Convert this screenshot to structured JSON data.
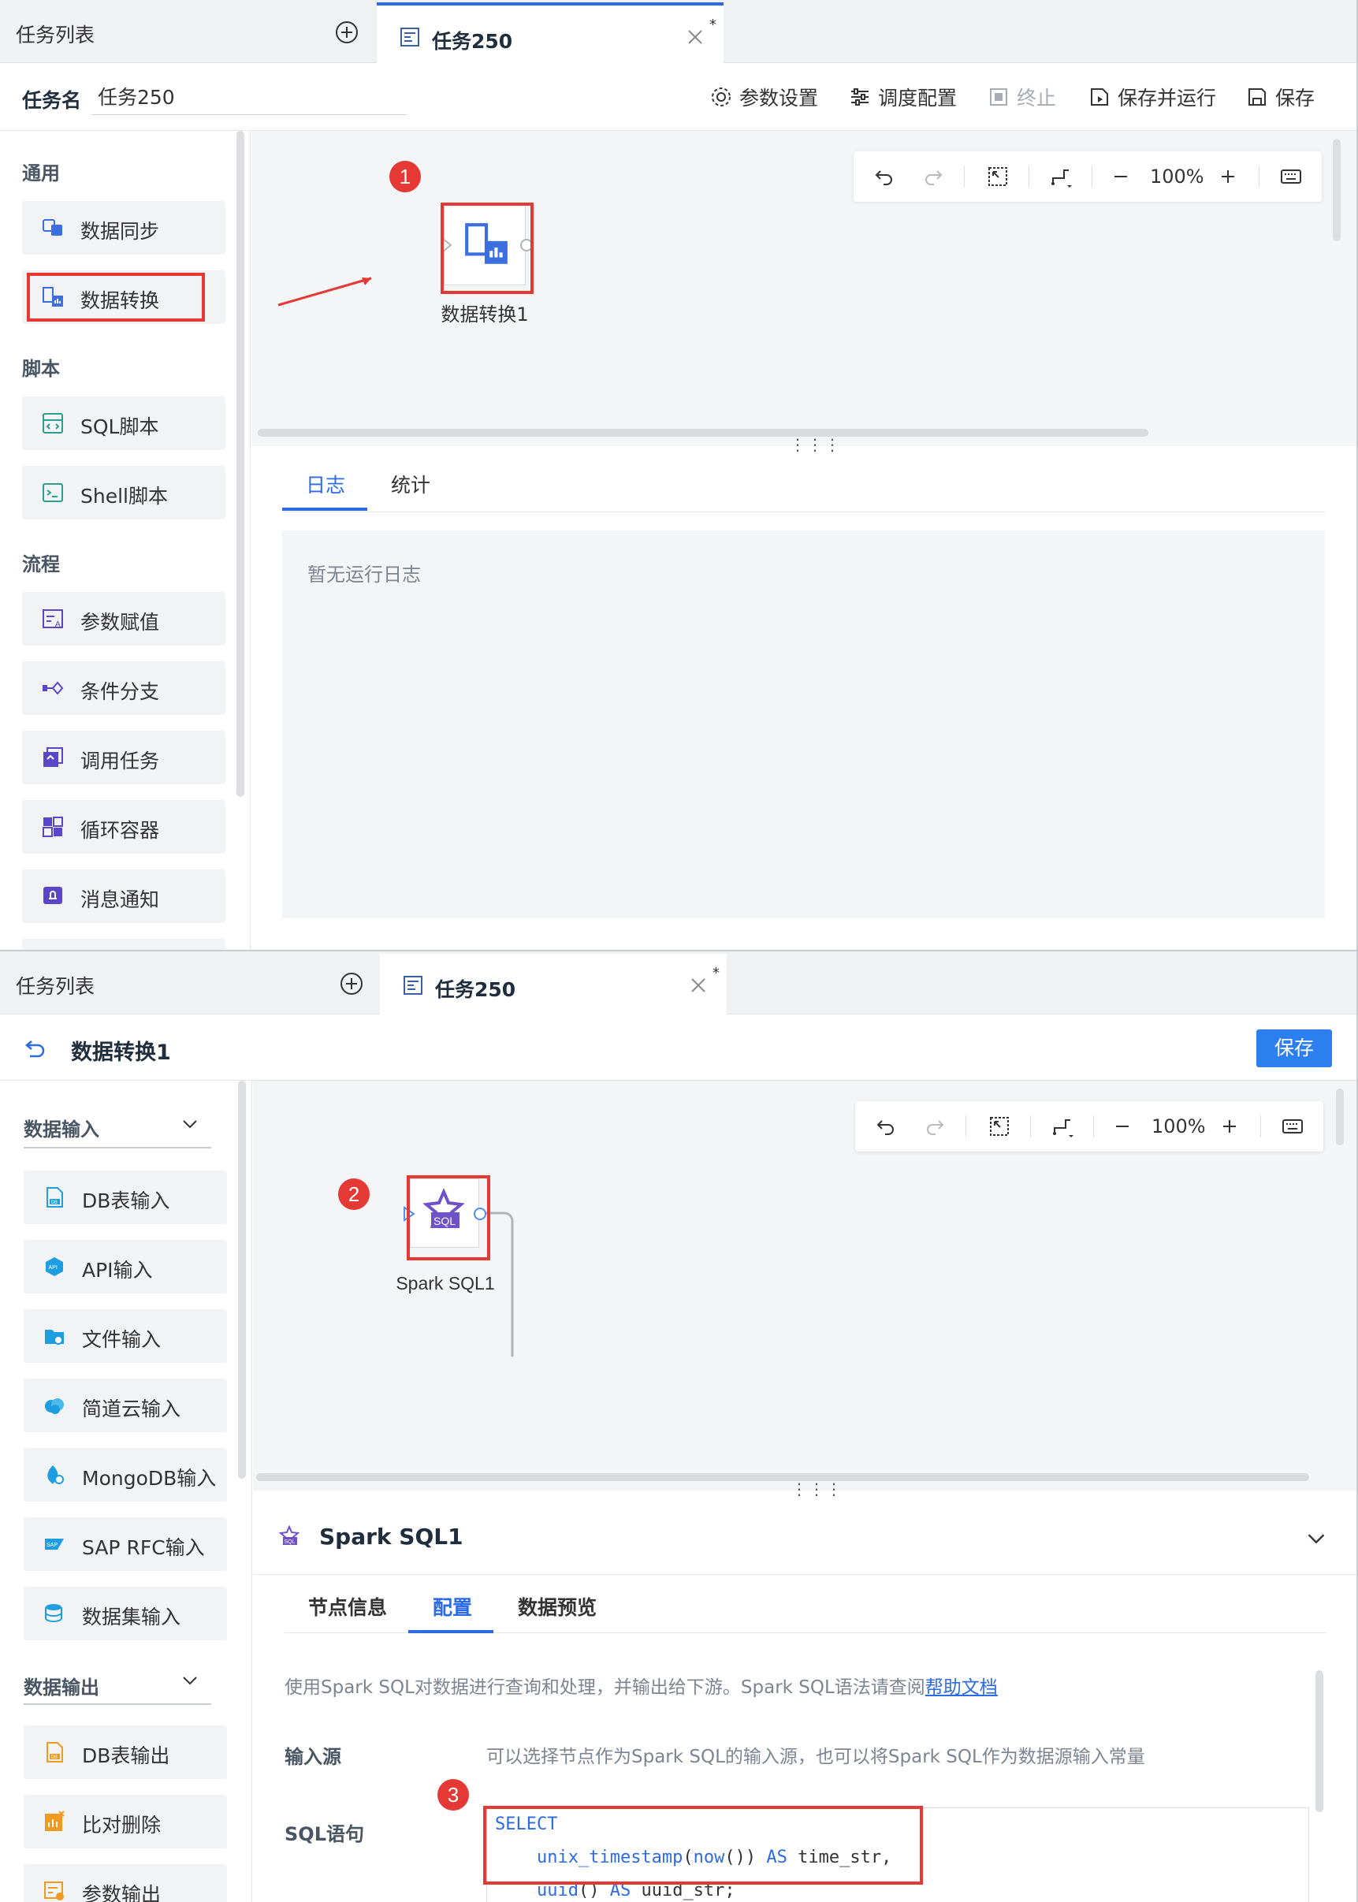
{
  "tabs": {
    "list_label": "任务列表",
    "active_tab": "任务250",
    "modified_mark": "*"
  },
  "panel1": {
    "task_name_label": "任务名",
    "task_name_value": "任务250",
    "toolbar": {
      "params": "参数设置",
      "schedule": "调度配置",
      "stop": "终止",
      "save_run": "保存并运行",
      "save": "保存"
    },
    "sections": {
      "general": "通用",
      "script": "脚本",
      "flow": "流程"
    },
    "items": {
      "data_sync": "数据同步",
      "data_transform": "数据转换",
      "sql_script": "SQL脚本",
      "shell_script": "Shell脚本",
      "param_assign": "参数赋值",
      "cond_branch": "条件分支",
      "call_task": "调用任务",
      "loop_container": "循环容器",
      "msg_notify": "消息通知"
    },
    "zoom": "100%",
    "node_label": "数据转换1",
    "badge": "1",
    "log_tabs": {
      "log": "日志",
      "stats": "统计"
    },
    "log_empty": "暂无运行日志"
  },
  "panel2": {
    "title": "数据转换1",
    "save": "保存",
    "sections": {
      "input": "数据输入",
      "output": "数据输出"
    },
    "inputs": {
      "db": "DB表输入",
      "api": "API输入",
      "file": "文件输入",
      "jiandao": "简道云输入",
      "mongo": "MongoDB输入",
      "sap": "SAP RFC输入",
      "dataset": "数据集输入"
    },
    "outputs": {
      "db": "DB表输出",
      "compare_delete": "比对删除",
      "param_out": "参数输出"
    },
    "zoom": "100%",
    "node_label": "Spark SQL1",
    "badge2": "2",
    "badge3": "3",
    "config_title": "Spark SQL1",
    "cfg_tabs": {
      "node_info": "节点信息",
      "config": "配置",
      "preview": "数据预览"
    },
    "desc_text": "使用Spark SQL对数据进行查询和处理，并输出给下游。Spark SQL语法请查阅",
    "help_link": "帮助文档",
    "input_source_label": "输入源",
    "input_source_hint": "可以选择节点作为Spark SQL的输入源，也可以将Spark SQL作为数据源输入常量",
    "sql_label": "SQL语句",
    "code": {
      "l1_kw": "SELECT",
      "l2_fn": "unix_timestamp",
      "l2_p1": "(",
      "l2_fn2": "now",
      "l2_p2": "()) ",
      "l2_as": "AS",
      "l2_rest": " time_str,",
      "l3_fn": "uuid",
      "l3_p": "() ",
      "l3_as": "AS",
      "l3_rest": " uuid_str;"
    }
  },
  "colors": {
    "accent": "#2d6be4",
    "highlight": "#e53935"
  }
}
